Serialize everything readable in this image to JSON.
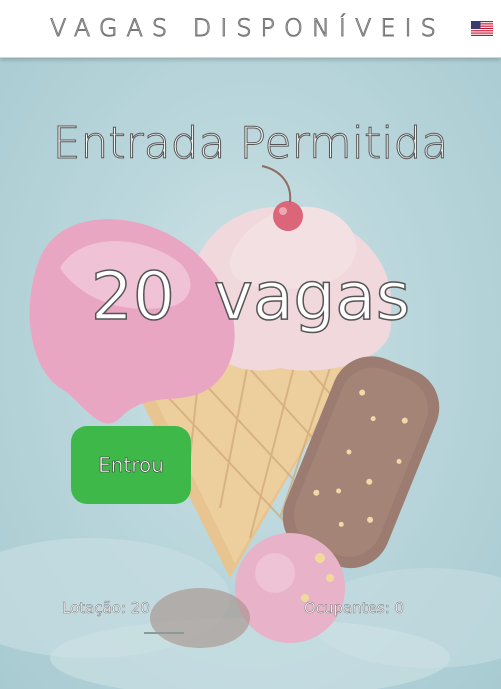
{
  "header": {
    "title": "VAGAS DISPONÍVEIS",
    "language_flag_icon": "us-flag-icon"
  },
  "main": {
    "status": "Entrada Permitida",
    "count_number": "20",
    "count_unit": "vagas",
    "entrou_button_label": "Entrou",
    "lotacao": "Lotação: 20",
    "ocupantes": "Ocupantes: 0"
  },
  "colors": {
    "button_green": "#3fb84a",
    "background": "#a8cdd3"
  }
}
